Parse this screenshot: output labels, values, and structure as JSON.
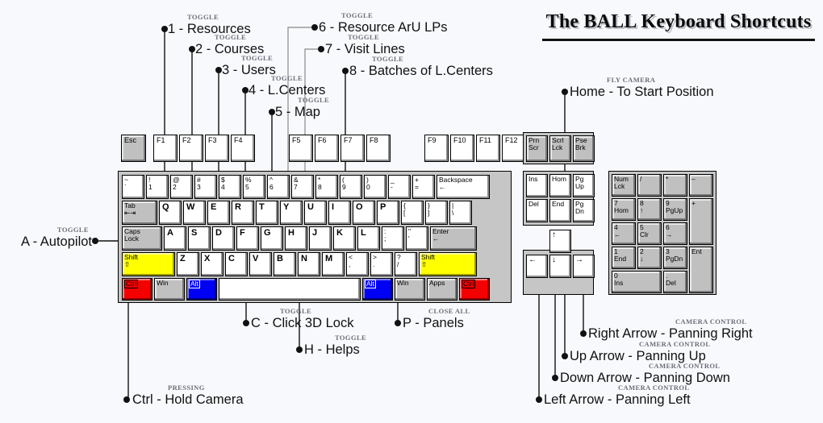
{
  "header": {
    "title": "The BALL Keyboard Shortcuts"
  },
  "background_color": "#f7f9fc",
  "colors": {
    "key_default": "#ffffff",
    "key_gray": "#c0c0c0",
    "ctrl_red": "#f40000",
    "alt_blue": "#0000f4",
    "shift_yellow": "#ffff00",
    "keyboard_frame": "#c6c6c6",
    "tag_text": "#6d6d78",
    "line_black": "#111111",
    "line_gray": "#9a9a9a"
  },
  "callouts": [
    {
      "id": "c1",
      "tag": "TOGGLE",
      "key": "1",
      "text": "1 - Resources",
      "target_key": "1"
    },
    {
      "id": "c2",
      "tag": "TOGGLE",
      "key": "2",
      "text": "2 - Courses",
      "target_key": "2"
    },
    {
      "id": "c3",
      "tag": "TOGGLE",
      "key": "3",
      "text": "3 - Users",
      "target_key": "3"
    },
    {
      "id": "c4",
      "tag": "TOGGLE",
      "key": "4",
      "text": "4 - L.Centers",
      "target_key": "4"
    },
    {
      "id": "c5",
      "tag": "TOGGLE",
      "key": "5",
      "text": "5 - Map",
      "target_key": "5"
    },
    {
      "id": "c6",
      "tag": "TOGGLE",
      "key": "6",
      "text": "6 - Resource ArU LPs",
      "target_key": "6"
    },
    {
      "id": "c7",
      "tag": "TOGGLE",
      "key": "7",
      "text": "7 - Visit Lines",
      "target_key": "7"
    },
    {
      "id": "c8",
      "tag": "TOGGLE",
      "key": "8",
      "text": "8 - Batches of L.Centers",
      "target_key": "8"
    },
    {
      "id": "ca",
      "tag": "TOGGLE",
      "key": "A",
      "text": "A - Autopilot",
      "target_key": "A"
    },
    {
      "id": "ch",
      "tag": "FLY CAMERA",
      "key": "Home",
      "text": "Home - To Start Position",
      "target_key": "Home"
    },
    {
      "id": "cc",
      "tag": "TOGGLE",
      "key": "C",
      "text": "C - Click 3D Lock",
      "target_key": "C"
    },
    {
      "id": "chh",
      "tag": "TOGGLE",
      "key": "H",
      "text": "H - Helps",
      "target_key": "H"
    },
    {
      "id": "cp",
      "tag": "CLOSE ALL",
      "key": "P",
      "text": "P - Panels",
      "target_key": "P"
    },
    {
      "id": "cctrl",
      "tag": "PRESSING",
      "key": "Ctrl",
      "text": "Ctrl - Hold Camera",
      "target_key": "Ctrl"
    },
    {
      "id": "car",
      "tag": "CAMERA CONTROL",
      "key": "Right Arrow",
      "text": "Right Arrow - Panning Right",
      "target_key": "ArrowRight"
    },
    {
      "id": "cau",
      "tag": "CAMERA CONTROL",
      "key": "Up Arrow",
      "text": "Up Arrow - Panning Up",
      "target_key": "ArrowUp"
    },
    {
      "id": "cad",
      "tag": "CAMERA CONTROL",
      "key": "Down Arrow",
      "text": "Down Arrow - Panning Down",
      "target_key": "ArrowDown"
    },
    {
      "id": "cal",
      "tag": "CAMERA CONTROL",
      "key": "Left Arrow",
      "text": "Left Arrow - Panning Left",
      "target_key": "ArrowLeft"
    }
  ],
  "keyboard": {
    "esc": "Esc",
    "function_keys": [
      "F1",
      "F2",
      "F3",
      "F4",
      "F5",
      "F6",
      "F7",
      "F8",
      "F9",
      "F10",
      "F11",
      "F12"
    ],
    "number_row": [
      {
        "top": "~",
        "bottom": "`"
      },
      {
        "top": "!",
        "bottom": "1"
      },
      {
        "top": "@",
        "bottom": "2"
      },
      {
        "top": "#",
        "bottom": "3"
      },
      {
        "top": "$",
        "bottom": "4"
      },
      {
        "top": "%",
        "bottom": "5"
      },
      {
        "top": "^",
        "bottom": "6"
      },
      {
        "top": "&",
        "bottom": "7"
      },
      {
        "top": "*",
        "bottom": "8"
      },
      {
        "top": "(",
        "bottom": "9"
      },
      {
        "top": ")",
        "bottom": "0"
      },
      {
        "top": "_",
        "bottom": "-"
      },
      {
        "top": "+",
        "bottom": "="
      }
    ],
    "backspace": {
      "label": "Backspace",
      "glyph": "←"
    },
    "tab": {
      "label": "Tab",
      "glyph": "⇤⇥"
    },
    "qwerty_row": [
      "Q",
      "W",
      "E",
      "R",
      "T",
      "Y",
      "U",
      "I",
      "O",
      "P"
    ],
    "qwerty_sym": [
      {
        "top": "{",
        "bottom": "["
      },
      {
        "top": "}",
        "bottom": "]"
      },
      {
        "top": "|",
        "bottom": "\\"
      }
    ],
    "caps_lock": {
      "line1": "Caps",
      "line2": "Lock"
    },
    "asdf_row": [
      "A",
      "S",
      "D",
      "F",
      "G",
      "H",
      "J",
      "K",
      "L"
    ],
    "asdf_sym": [
      {
        "top": ":",
        "bottom": ";"
      },
      {
        "top": "\"",
        "bottom": "'"
      }
    ],
    "enter": {
      "label": "Enter",
      "glyph": "←"
    },
    "shift": {
      "label": "Shift",
      "glyph": "⇧"
    },
    "zxcv_row": [
      "Z",
      "X",
      "C",
      "V",
      "B",
      "N",
      "M"
    ],
    "zxcv_sym": [
      {
        "top": "<",
        "bottom": ","
      },
      {
        "top": ">",
        "bottom": "."
      },
      {
        "top": "?",
        "bottom": "/"
      }
    ],
    "bottom_row": [
      {
        "label": "Ctrl",
        "color": "red",
        "boxed": true
      },
      {
        "label": "Win",
        "color": "gray",
        "boxed": false
      },
      {
        "label": "Alt",
        "color": "blue",
        "boxed": true
      },
      {
        "label": "",
        "color": "white",
        "boxed": false
      },
      {
        "label": "Alt",
        "color": "blue",
        "boxed": true
      },
      {
        "label": "Win",
        "color": "gray",
        "boxed": false
      },
      {
        "label": "Apps",
        "color": "gray",
        "boxed": false
      },
      {
        "label": "Ctrl",
        "color": "red",
        "boxed": true
      }
    ],
    "sys_block": [
      {
        "line1": "Prn",
        "line2": "Scr"
      },
      {
        "line1": "Scrl",
        "line2": "Lck"
      },
      {
        "line1": "Pse",
        "line2": "Brk"
      }
    ],
    "nav_block": [
      {
        "line1": "Ins",
        "line2": ""
      },
      {
        "line1": "Hom",
        "line2": ""
      },
      {
        "line1": "Pg",
        "line2": "Up"
      },
      {
        "line1": "Del",
        "line2": ""
      },
      {
        "line1": "End",
        "line2": ""
      },
      {
        "line1": "Pg",
        "line2": "Dn"
      }
    ],
    "arrow_block": {
      "up": "↑",
      "left": "←",
      "down": "↓",
      "right": "→"
    },
    "numpad": [
      {
        "line1": "Num",
        "line2": "Lck"
      },
      {
        "line1": "/",
        "line2": ""
      },
      {
        "line1": "*",
        "line2": ""
      },
      {
        "line1": "–",
        "line2": ""
      },
      {
        "line1": "7",
        "line2": "Hom"
      },
      {
        "line1": "8",
        "line2": "↑"
      },
      {
        "line1": "9",
        "line2": "PgUp"
      },
      {
        "line1": "+",
        "line2": ""
      },
      {
        "line1": "4",
        "line2": "←"
      },
      {
        "line1": "5",
        "line2": "Clr"
      },
      {
        "line1": "6",
        "line2": "→"
      },
      {
        "line1": "1",
        "line2": "End"
      },
      {
        "line1": "2",
        "line2": "↓"
      },
      {
        "line1": "3",
        "line2": "PgDn"
      },
      {
        "line1": "Ent",
        "line2": ""
      },
      {
        "line1": "0",
        "line2": "Ins"
      },
      {
        "line1": ".",
        "line2": "Del"
      }
    ]
  }
}
